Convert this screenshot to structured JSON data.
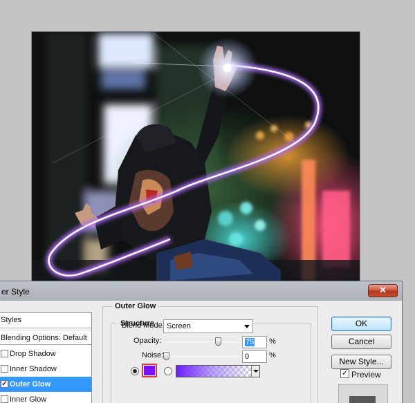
{
  "dialog": {
    "title": "er Style",
    "close_label": "✕"
  },
  "styles_list": {
    "header": "Styles",
    "blending_options": "Blending Options: Default",
    "items": [
      {
        "label": "Drop Shadow",
        "checked": false,
        "selected": false
      },
      {
        "label": "Inner Shadow",
        "checked": false,
        "selected": false
      },
      {
        "label": "Outer Glow",
        "checked": true,
        "selected": true
      },
      {
        "label": "Inner Glow",
        "checked": false,
        "selected": false
      }
    ],
    "check_mark": "✓"
  },
  "outer_glow": {
    "section_title": "Outer Glow",
    "structure_title": "Structure",
    "blend_mode_label": "Blend Mode:",
    "blend_mode_value": "Screen",
    "opacity_label": "Opacity:",
    "opacity_value": "75",
    "noise_label": "Noise:",
    "noise_value": "0",
    "percent": "%",
    "glow_color": "#7b10ff"
  },
  "buttons": {
    "ok": "OK",
    "cancel": "Cancel",
    "new_style": "New Style...",
    "preview_label": "Preview",
    "preview_checked": true,
    "check_mark": "✓"
  }
}
